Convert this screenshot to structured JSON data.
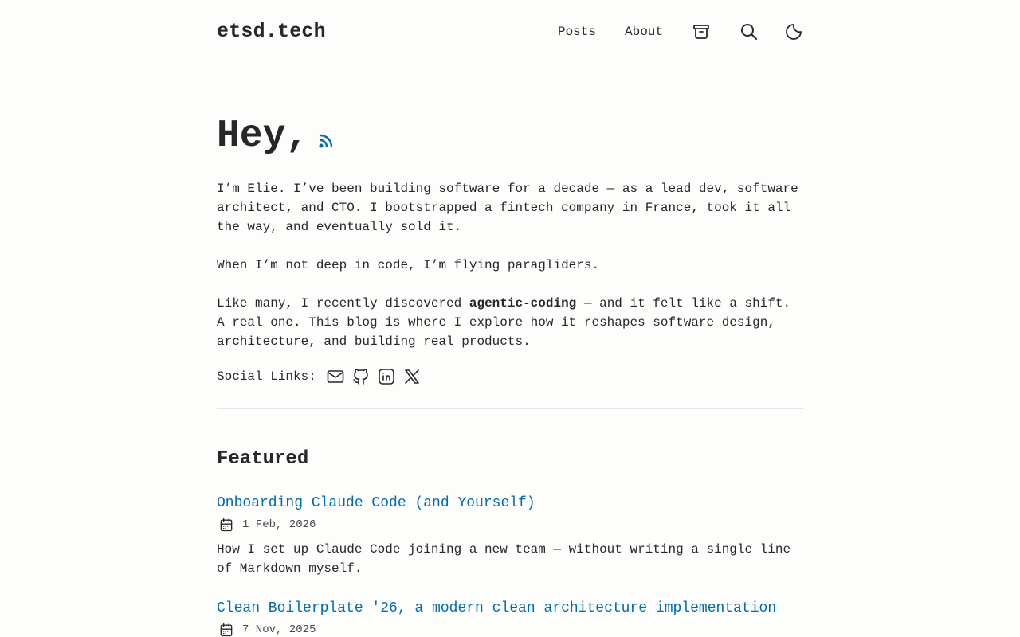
{
  "site": {
    "logo": "etsd.tech"
  },
  "nav": {
    "posts": "Posts",
    "about": "About",
    "icons": [
      "archive-icon",
      "search-icon",
      "moon-icon"
    ]
  },
  "hero": {
    "title": "Hey,",
    "rss_icon": "rss-icon"
  },
  "intro": {
    "p1": "I’m Elie. I’ve been building software for a decade — as a lead dev, software architect, and CTO. I bootstrapped a fintech company in France, took it all the way, and eventually sold it.",
    "p2": "When I’m not deep in code, I’m flying paragliders.",
    "p3_before": "Like many, I recently discovered ",
    "p3_bold": "agentic-coding",
    "p3_after": " — and it felt like a shift. A real one. This blog is where I explore how it reshapes software design, architecture, and building real products."
  },
  "social": {
    "label": "Social Links:",
    "icons": [
      "mail-icon",
      "github-icon",
      "linkedin-icon",
      "x-icon"
    ]
  },
  "featured": {
    "heading": "Featured",
    "posts": [
      {
        "title": "Onboarding Claude Code (and Yourself)",
        "date": "1 Feb, 2026",
        "description": "How I set up Claude Code joining a new team — without writing a single line of Markdown myself."
      },
      {
        "title": "Clean Boilerplate '26, a modern clean architecture implementation",
        "date": "7 Nov, 2025",
        "description": ""
      }
    ]
  },
  "colors": {
    "background": "#fdfdfc",
    "text": "#282728",
    "accent": "#006cac",
    "border": "#e6e6e6"
  }
}
